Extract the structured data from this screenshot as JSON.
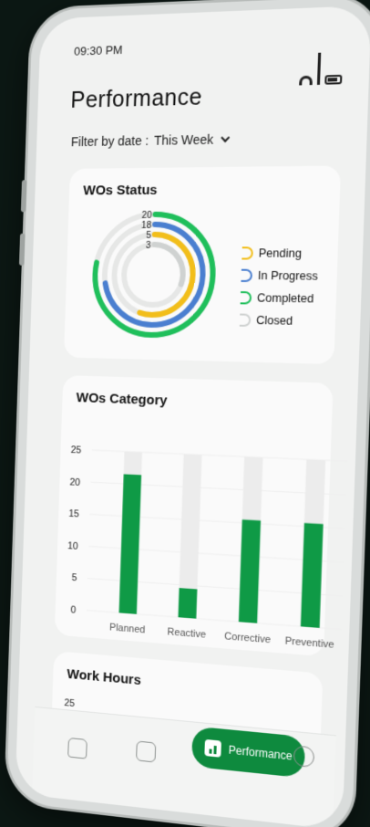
{
  "status_bar": {
    "time": "09:30 PM"
  },
  "header": {
    "title": "Performance"
  },
  "filter": {
    "label": "Filter by date :",
    "value": "This Week"
  },
  "wos_status": {
    "title": "WOs Status",
    "rings": [
      {
        "label": "Pending",
        "count": "5",
        "color": "#f2be1a",
        "fraction": 0.55
      },
      {
        "label": "In Progress",
        "count": "18",
        "color": "#4a7fd0",
        "fraction": 0.72
      },
      {
        "label": "Completed",
        "count": "20",
        "color": "#1fbf5b",
        "fraction": 0.78
      },
      {
        "label": "Closed",
        "count": "3",
        "color": "#cfd2d1",
        "fraction": 0.3
      }
    ]
  },
  "wos_category": {
    "title": "WOs Category",
    "chart_data": {
      "type": "bar",
      "categories": [
        "Planned",
        "Reactive",
        "Corrective",
        "Preventive"
      ],
      "values": [
        21.5,
        4.5,
        15.5,
        15.5
      ],
      "ylim": [
        0,
        25
      ],
      "yticks": [
        0,
        5,
        10,
        15,
        20,
        25
      ],
      "bar_color": "#0f9a46",
      "background_color": "#ececec"
    }
  },
  "work_hours": {
    "title": "Work Hours",
    "first_tick": "25"
  },
  "bottom_nav": {
    "active_label": "Performance",
    "items": [
      {
        "name": "home-icon"
      },
      {
        "name": "checklist-icon"
      },
      {
        "name": "performance-icon"
      },
      {
        "name": "user-icon"
      }
    ]
  }
}
